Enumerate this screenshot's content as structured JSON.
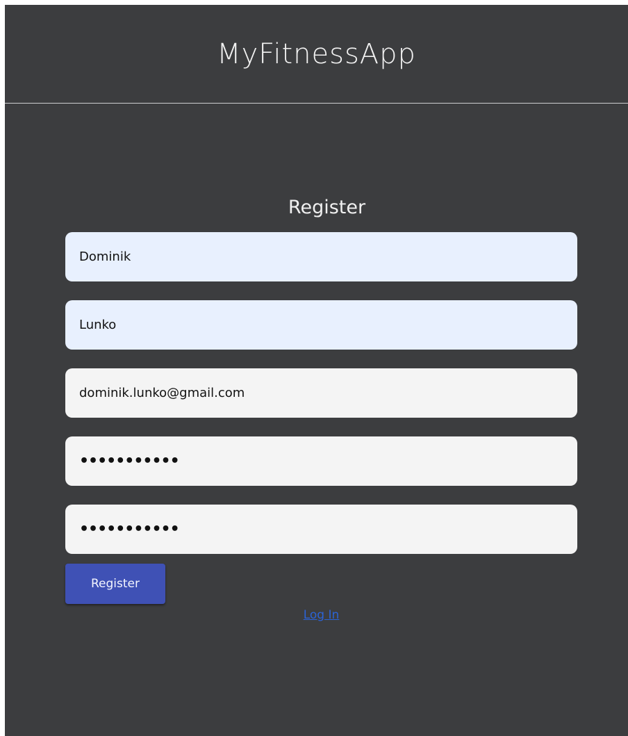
{
  "header": {
    "title": "MyFitnessApp"
  },
  "form": {
    "title": "Register",
    "fields": [
      {
        "name": "first-name",
        "value": "Dominik"
      },
      {
        "name": "last-name",
        "value": "Lunko"
      },
      {
        "name": "email",
        "value": "dominik.lunko@gmail.com"
      },
      {
        "name": "password",
        "value": "•••••••••••"
      },
      {
        "name": "confirm-password",
        "value": "•••••••••••"
      }
    ],
    "submit_label": "Register",
    "login_link": "Log In"
  },
  "colors": {
    "background": "#3c3d3f",
    "autofill_field": "#e8f0fe",
    "field": "#f4f4f4",
    "primary_button": "#3f51b5",
    "link": "#2b63d6"
  }
}
